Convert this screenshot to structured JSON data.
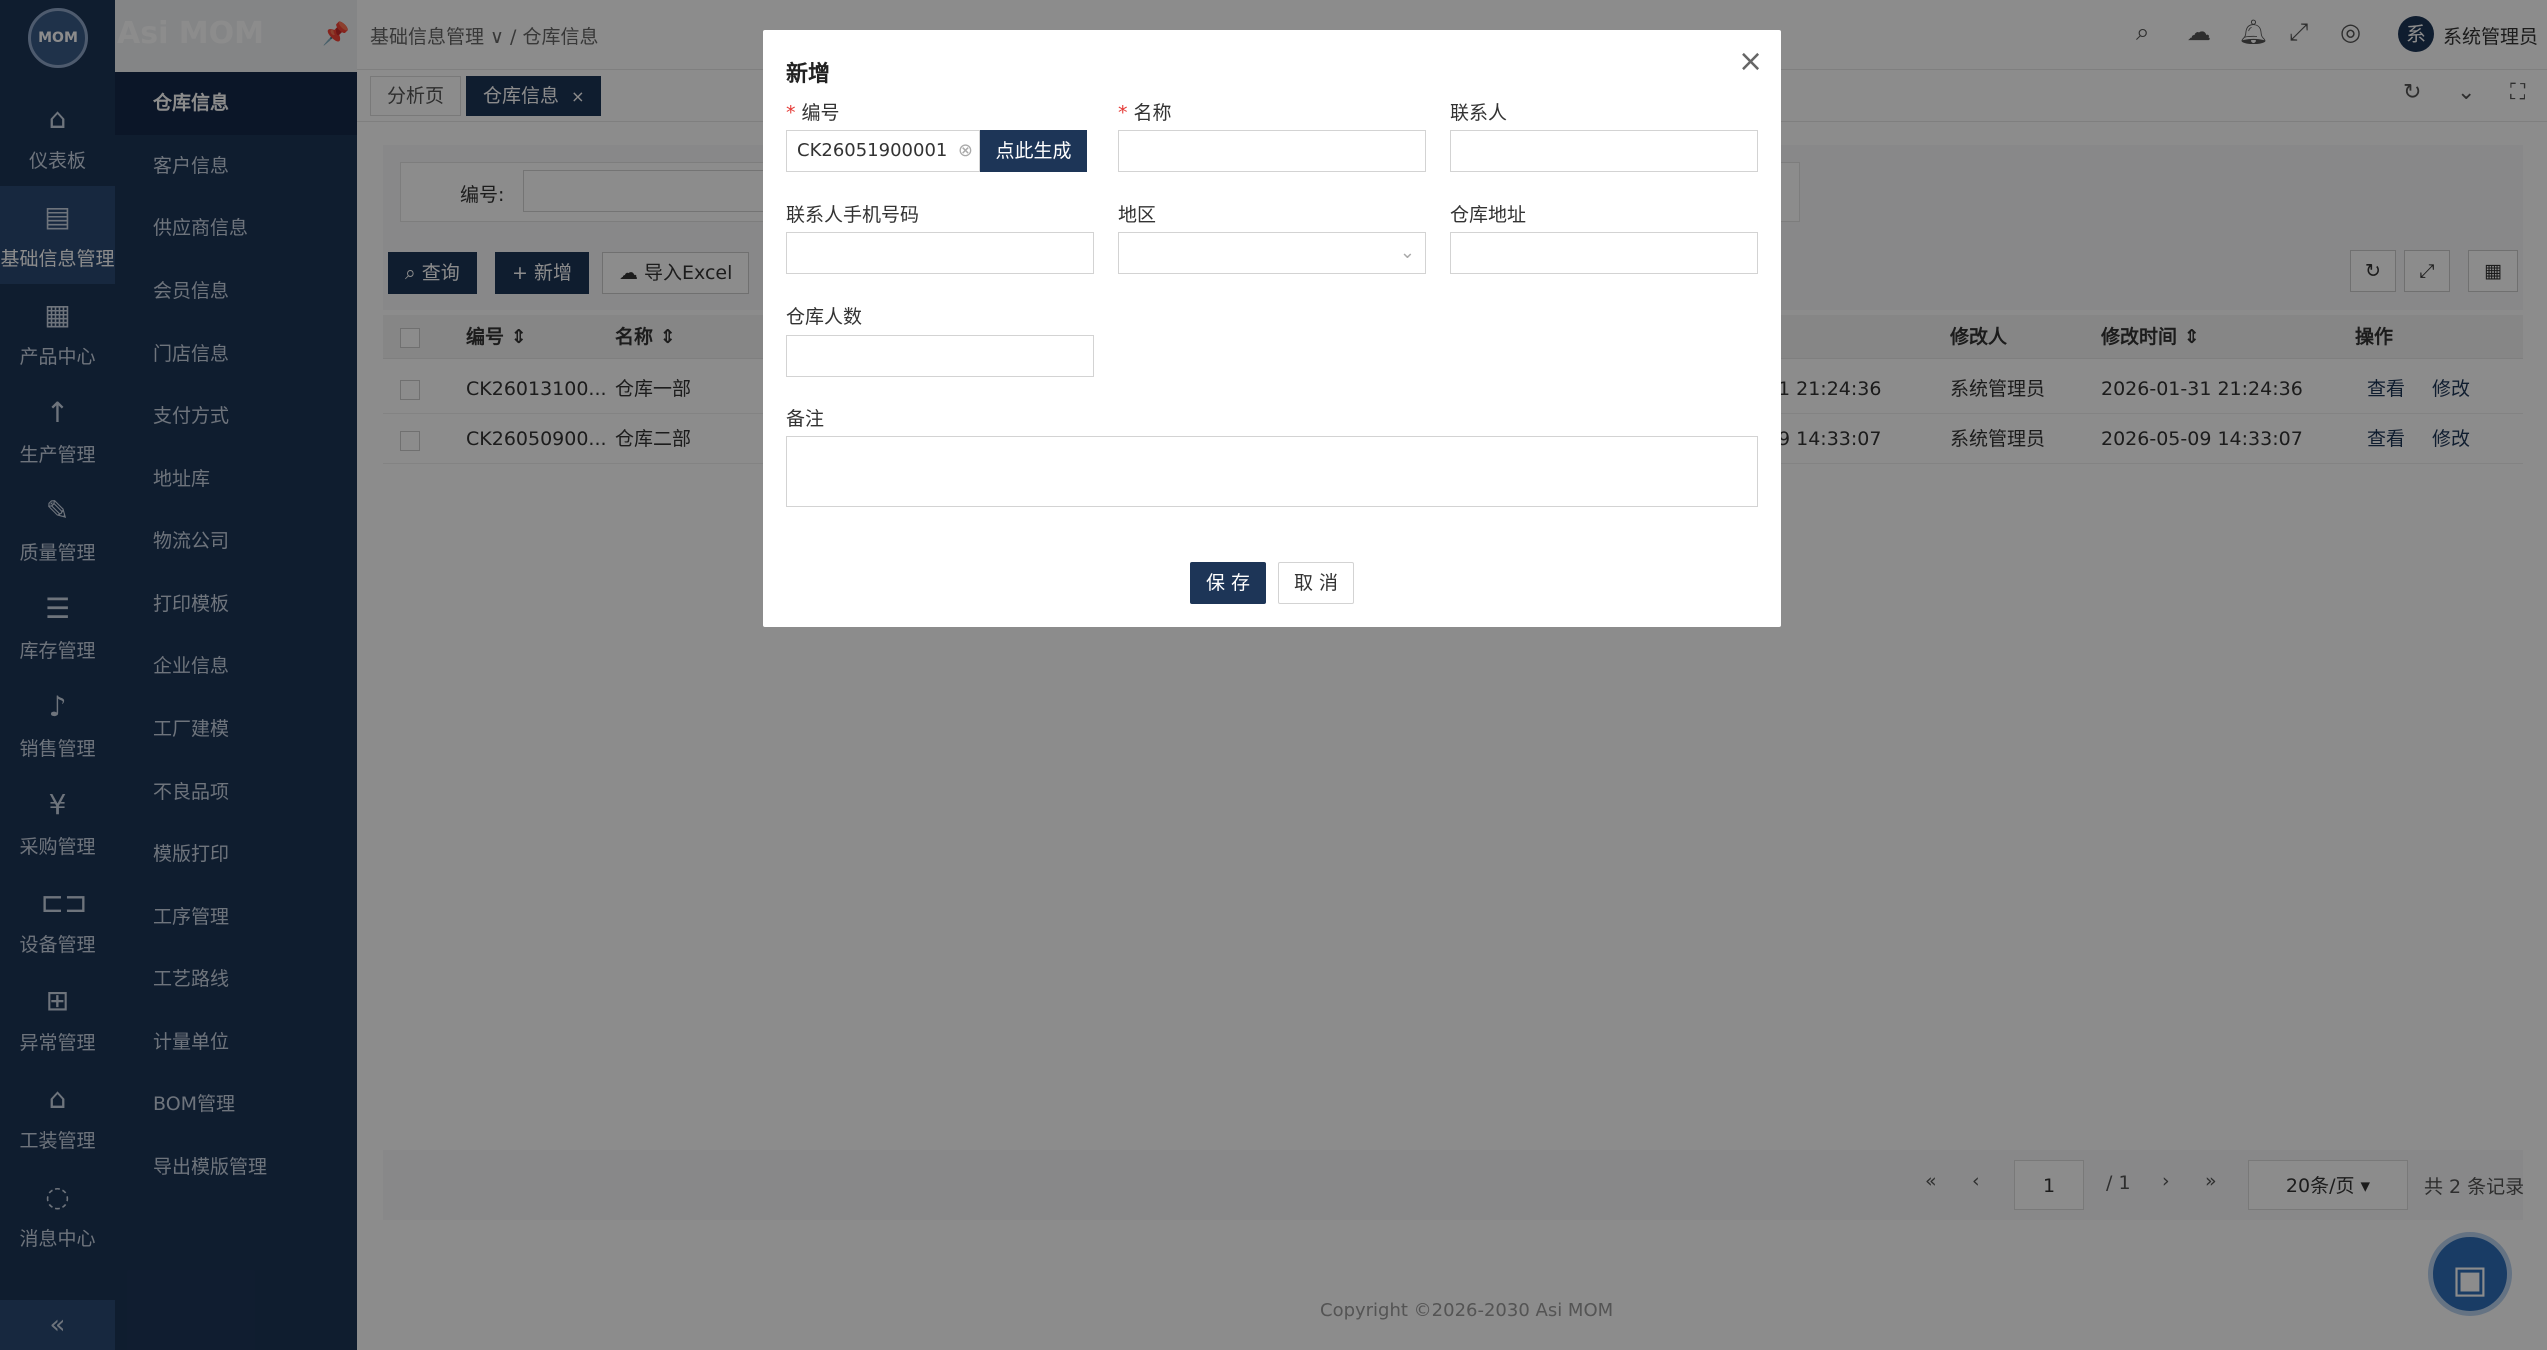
{
  "app": {
    "logo": "MOM",
    "title": "Asi MOM"
  },
  "rail": [
    {
      "label": "仪表板",
      "icon": "home-icon"
    },
    {
      "label": "基础信息管理",
      "icon": "document-icon"
    },
    {
      "label": "产品中心",
      "icon": "grid-icon"
    },
    {
      "label": "生产管理",
      "icon": "arrow-up-icon"
    },
    {
      "label": "质量管理",
      "icon": "tool-icon"
    },
    {
      "label": "库存管理",
      "icon": "list-icon"
    },
    {
      "label": "销售管理",
      "icon": "bell-icon"
    },
    {
      "label": "采购管理",
      "icon": "cart-icon"
    },
    {
      "label": "设备管理",
      "icon": "device-icon"
    },
    {
      "label": "异常管理",
      "icon": "tree-icon"
    },
    {
      "label": "工装管理",
      "icon": "bank-icon"
    },
    {
      "label": "消息中心",
      "icon": "message-icon"
    }
  ],
  "submenu": [
    "仓库信息",
    "客户信息",
    "供应商信息",
    "会员信息",
    "门店信息",
    "支付方式",
    "地址库",
    "物流公司",
    "打印模板",
    "企业信息",
    "工厂建模",
    "不良品项",
    "模版打印",
    "工序管理",
    "工艺路线",
    "计量单位",
    "BOM管理",
    "导出模版管理"
  ],
  "header": {
    "breadcrumb_parent": "基础信息管理",
    "breadcrumb_current": "仓库信息",
    "user_avatar": "系",
    "user_name": "系统管理员"
  },
  "tabs": [
    {
      "label": "分析页"
    },
    {
      "label": "仓库信息",
      "close": "×"
    }
  ],
  "search": {
    "code_label": "编号:"
  },
  "toolbar": {
    "query": "查询",
    "add": "新增",
    "import": "导入Excel"
  },
  "table": {
    "headers": {
      "code": "编号",
      "name": "名称",
      "modifier": "修改人",
      "modified_time": "修改时间",
      "action": "操作"
    },
    "rows": [
      {
        "code": "CK26013100...",
        "name": "仓库一部",
        "created_tail": "1 21:24:36",
        "modifier": "系统管理员",
        "modified_time": "2026-01-31 21:24:36",
        "view": "查看",
        "edit": "修改"
      },
      {
        "code": "CK26050900...",
        "name": "仓库二部",
        "created_tail": "9 14:33:07",
        "modifier": "系统管理员",
        "modified_time": "2026-05-09 14:33:07",
        "view": "查看",
        "edit": "修改"
      }
    ]
  },
  "pager": {
    "page": "1",
    "total_pages": "/ 1",
    "page_size": "20条/页",
    "total": "共 2 条记录"
  },
  "footer": {
    "copyright": "Copyright ©2026-2030 Asi MOM"
  },
  "modal": {
    "title": "新增",
    "fields": {
      "code_label": "编号",
      "code_value": "CK26051900001",
      "generate": "点此生成",
      "name_label": "名称",
      "contact_label": "联系人",
      "phone_label": "联系人手机号码",
      "region_label": "地区",
      "address_label": "仓库地址",
      "headcount_label": "仓库人数",
      "remark_label": "备注"
    },
    "save": "保 存",
    "cancel": "取 消"
  }
}
